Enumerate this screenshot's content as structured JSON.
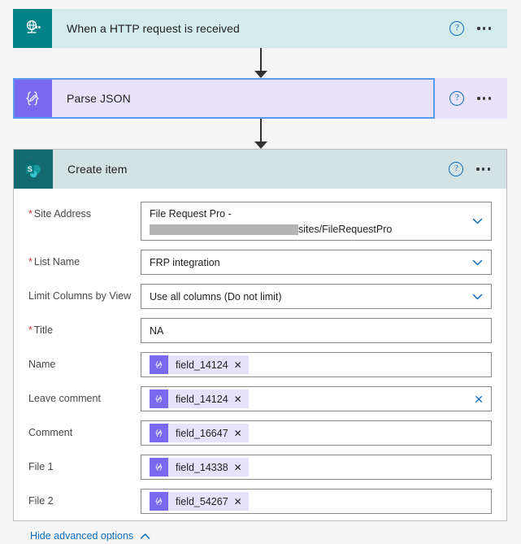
{
  "theme": {
    "trigger_header_bg": "#d3ebeb",
    "trigger_icon_bg": "#038387",
    "parse_header_bg": "#e8e3fb",
    "parse_icon_bg": "#7a69ee",
    "create_header_bg": "#d3e3e3",
    "create_icon_bg": "#136b70",
    "selection_border": "#5b9bef",
    "link_blue": "#0f6cbd",
    "required_red": "#d13438",
    "token_bg": "#e7e2fb",
    "page_bg": "#f5f5f5"
  },
  "cards": {
    "trigger": {
      "title": "When a HTTP request is received",
      "icon": "http-globe-icon",
      "help_label": "?",
      "more_label": "More commands"
    },
    "parse": {
      "title": "Parse JSON",
      "icon": "parse-json-braces-icon",
      "selected": true,
      "help_label": "?",
      "more_label": "More commands"
    },
    "create": {
      "title": "Create item",
      "icon": "sharepoint-icon",
      "help_label": "?",
      "more_label": "More commands"
    }
  },
  "form": {
    "fields": [
      {
        "label": "Site Address",
        "required": true,
        "type": "dropdown-two-line",
        "value_line1": "File Request Pro -",
        "redacted": true,
        "value_line2": "sites/FileRequestPro",
        "name": "site-address"
      },
      {
        "label": "List Name",
        "required": true,
        "type": "dropdown",
        "value": "FRP integration",
        "name": "list-name"
      },
      {
        "label": "Limit Columns by View",
        "required": false,
        "type": "dropdown",
        "value": "Use all columns (Do not limit)",
        "name": "limit-columns-by-view"
      },
      {
        "label": "Title",
        "required": true,
        "type": "text",
        "value": "NA",
        "name": "title"
      },
      {
        "label": "Name",
        "required": false,
        "type": "token",
        "token": "field_14124",
        "token_remove": "✕",
        "clear": false,
        "name": "name"
      },
      {
        "label": "Leave comment",
        "required": false,
        "type": "token",
        "token": "field_14124",
        "token_remove": "✕",
        "clear": true,
        "clear_label": "✕",
        "name": "leave-comment"
      },
      {
        "label": "Comment",
        "required": false,
        "type": "token",
        "token": "field_16647",
        "token_remove": "✕",
        "clear": false,
        "name": "comment"
      },
      {
        "label": "File 1",
        "required": false,
        "type": "token",
        "token": "field_14338",
        "token_remove": "✕",
        "clear": false,
        "name": "file-1"
      },
      {
        "label": "File 2",
        "required": false,
        "type": "token",
        "token": "field_54267",
        "token_remove": "✕",
        "clear": false,
        "name": "file-2"
      }
    ],
    "advanced_options_label": "Hide advanced options"
  }
}
